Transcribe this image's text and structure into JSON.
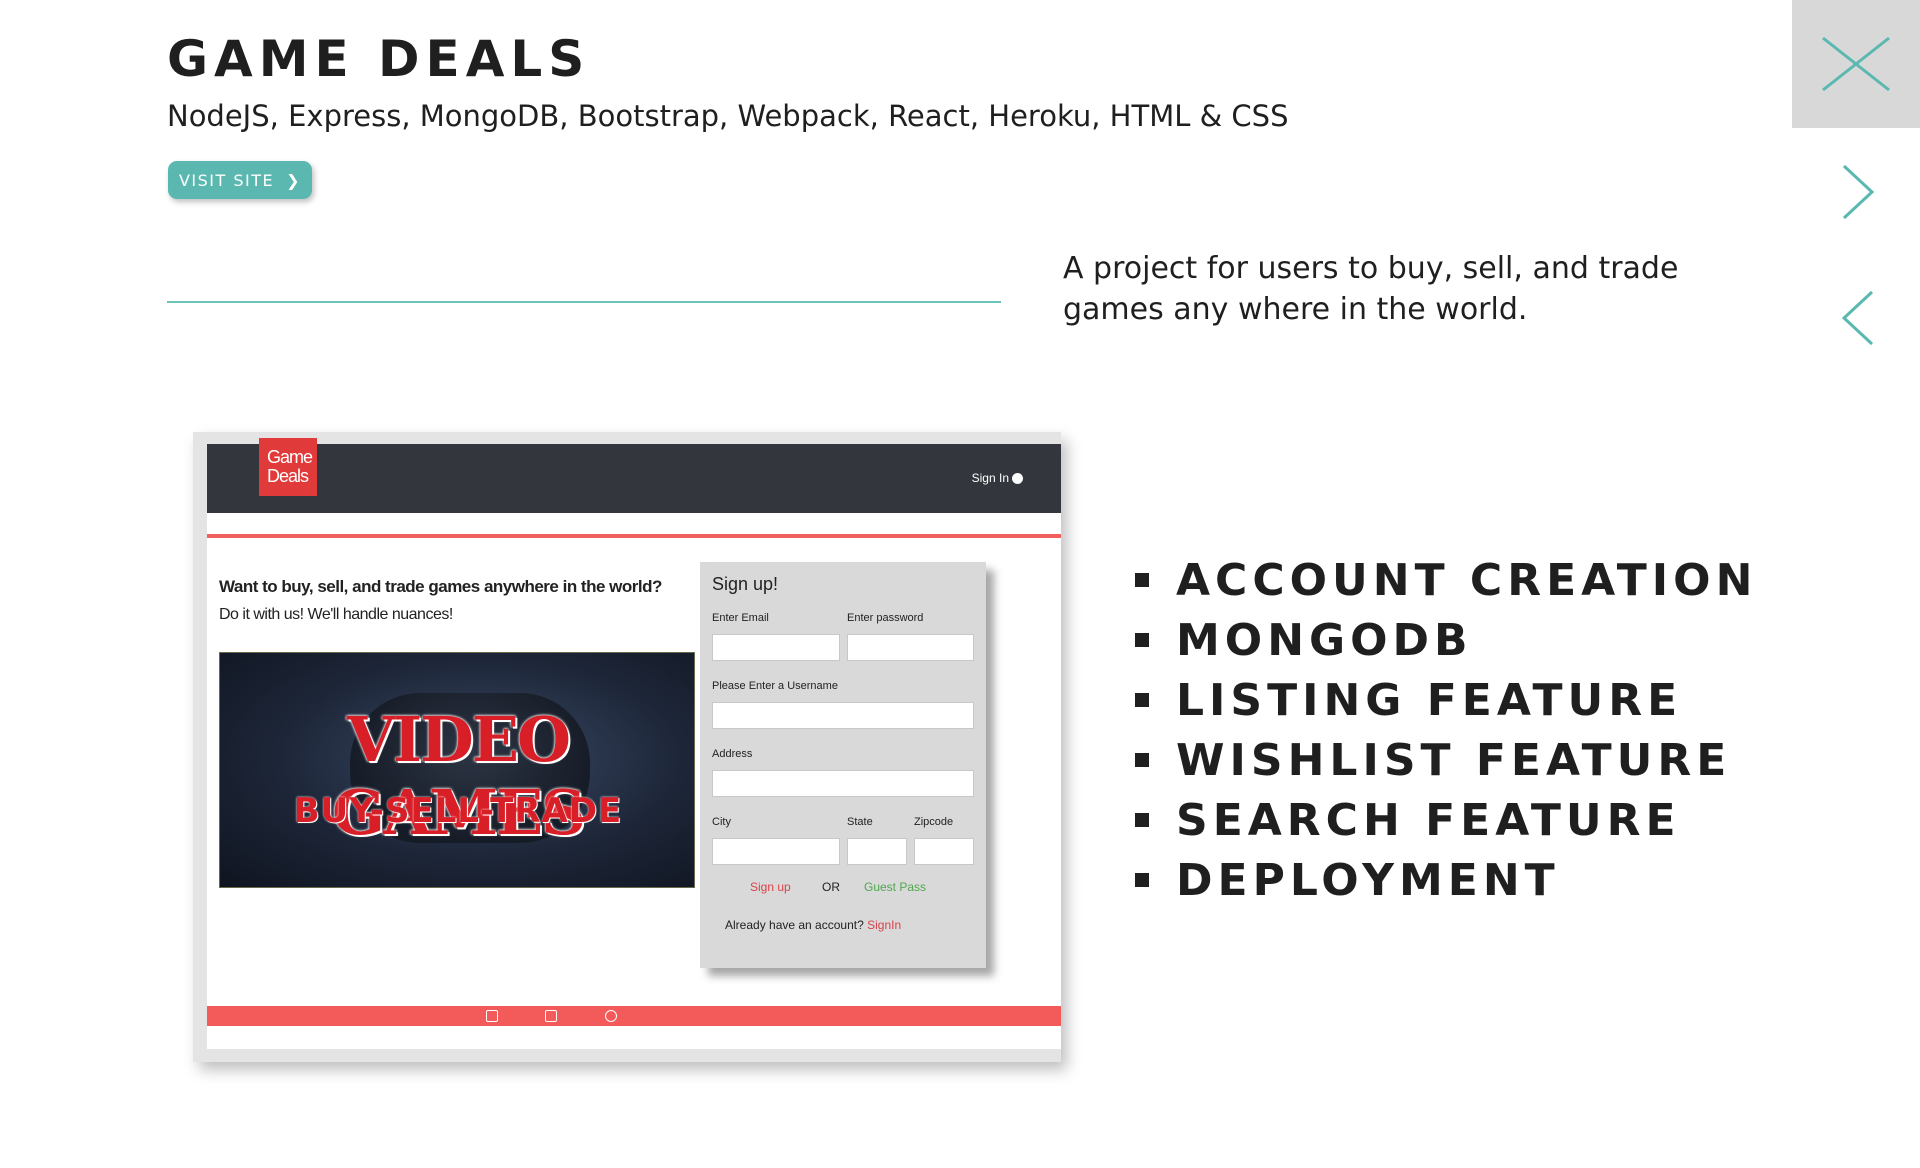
{
  "project": {
    "title": "Game Deals",
    "tech_stack": "NodeJS, Express, MongoDB, Bootstrap, Webpack, React, Heroku, HTML & CSS",
    "visit_label": "VISIT SITE",
    "visit_chevron": "❯",
    "description": "A project for users to buy, sell, and trade games any where in the world."
  },
  "features": [
    "Account Creation",
    "MongoDB",
    "Listing Feature",
    "Wishlist Feature",
    "Search Feature",
    "Deployment"
  ],
  "preview": {
    "logo_line1": "Game",
    "logo_line2": "Deals",
    "nav_signin": "Sign In",
    "headline": "Want to buy, sell, and trade games anywhere in the world?",
    "subline": "Do it with us! We'll handle nuances!",
    "banner_title": "VIDEO GAMES",
    "banner_subtitle": "BUY-SELL-TRADE",
    "form": {
      "title": "Sign up!",
      "email_label": "Enter Email",
      "password_label": "Enter password",
      "username_label": "Please Enter a Username",
      "address_label": "Address",
      "city_label": "City",
      "state_label": "State",
      "zipcode_label": "Zipcode",
      "signup_label": "Sign up",
      "or_label": "OR",
      "guest_label": "Guest Pass",
      "already_label": "Already have an account?",
      "signin_label": "SignIn"
    }
  },
  "icons": {
    "close": "close-icon",
    "next": "chevron-right-icon",
    "prev": "chevron-left-icon",
    "footer": [
      "linkedin-icon",
      "github-icon",
      "codepen-icon"
    ]
  },
  "colors": {
    "accent_teal": "#5ab8b0",
    "nav_dark": "#33373d",
    "brand_red": "#e13a3a",
    "close_panel": "#d8d8d8"
  }
}
